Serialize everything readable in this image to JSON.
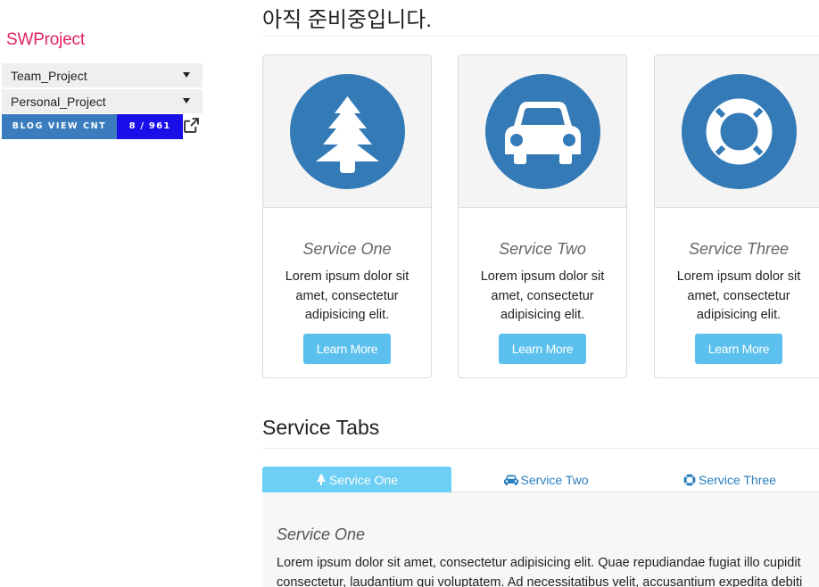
{
  "sidebar": {
    "brand": "SWProject",
    "items": [
      {
        "label": "Team_Project"
      },
      {
        "label": "Personal_Project"
      }
    ],
    "badge": {
      "label": "BLOG VIEW CNT",
      "value": "8 / 961"
    }
  },
  "main": {
    "title": "아직 준비중입니다.",
    "cards": [
      {
        "title": "Service One",
        "text": "Lorem ipsum dolor sit amet, consectetur adipisicing elit.",
        "button": "Learn More",
        "icon": "tree-icon"
      },
      {
        "title": "Service Two",
        "text": "Lorem ipsum dolor sit amet, consectetur adipisicing elit.",
        "button": "Learn More",
        "icon": "car-icon"
      },
      {
        "title": "Service Three",
        "text": "Lorem ipsum dolor sit amet, consectetur adipisicing elit.",
        "button": "Learn More",
        "icon": "life-ring-icon"
      }
    ],
    "tabs_heading": "Service Tabs",
    "tabs": [
      {
        "label": "Service One",
        "icon": "tree-icon"
      },
      {
        "label": "Service Two",
        "icon": "car-icon"
      },
      {
        "label": "Service Three",
        "icon": "life-ring-icon"
      }
    ],
    "panel": {
      "title": "Service One",
      "line1": "Lorem ipsum dolor sit amet, consectetur adipisicing elit. Quae repudiandae fugiat illo cupidit",
      "line2": "consectetur, laudantium qui voluptatem. Ad necessitatibus velit, accusantium expedita debiti"
    }
  },
  "colors": {
    "brand": "#e0245e",
    "primary": "#337ab7",
    "button": "#5bc0ed",
    "active_tab": "#6ccff3",
    "badge_label": "#3a7cbe",
    "badge_value": "#1a0fe8"
  }
}
